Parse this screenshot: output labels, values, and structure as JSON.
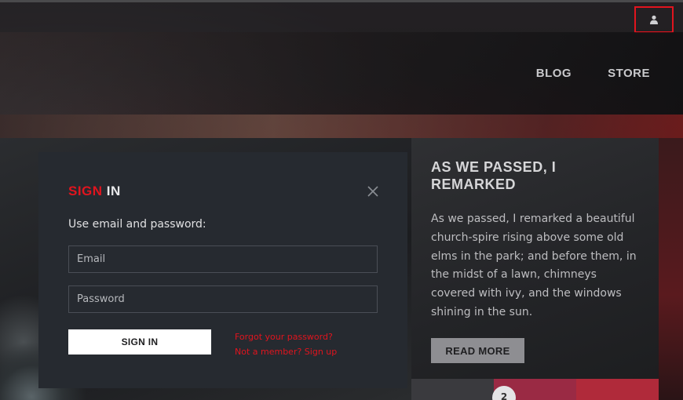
{
  "userbar": {
    "user_icon": "user-icon",
    "accent_color": "#e1141e"
  },
  "nav": {
    "items": [
      {
        "label": "BLOG"
      },
      {
        "label": "STORE"
      }
    ]
  },
  "article": {
    "title": "AS WE PASSED, I REMARKED",
    "body": "As we passed, I remarked a beautiful church-spire rising above some old elms in the park; and before them, in the midst of a lawn, chimneys covered with ivy, and the windows shining in the sun.",
    "read_more_label": "READ MORE"
  },
  "slider": {
    "badge": "2"
  },
  "signin": {
    "title_accent": "SIGN",
    "title_rest": "IN",
    "instructions": "Use email and password:",
    "email_placeholder": "Email",
    "password_placeholder": "Password",
    "button_label": "SIGN IN",
    "forgot_link": "Forgot your password?",
    "signup_link": "Not a member? Sign up",
    "close_icon": "close-icon"
  }
}
